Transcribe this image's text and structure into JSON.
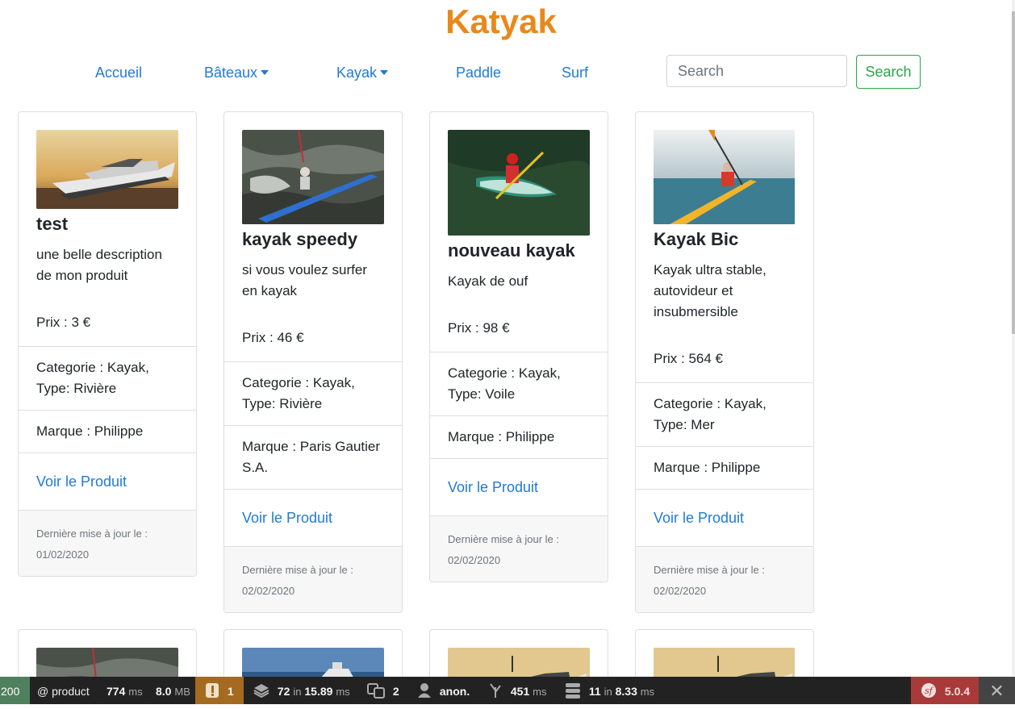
{
  "site": {
    "title": "Katyak"
  },
  "nav": {
    "accueil": "Accueil",
    "bateaux": "Bâteaux",
    "kayak": "Kayak",
    "paddle": "Paddle",
    "surf": "Surf",
    "search_placeholder": "Search",
    "search_button": "Search"
  },
  "products": [
    {
      "title": "test",
      "description": "une belle description de mon produit",
      "price": "Prix : 3 €",
      "category": "Categorie : Kayak, Type: Rivière",
      "brand": "Marque : Philippe",
      "link": "Voir le Produit",
      "updated_label": "Dernière mise à jour le :",
      "updated_date": "01/02/2020"
    },
    {
      "title": "kayak speedy",
      "description": "si vous voulez surfer en kayak",
      "price": "Prix : 46 €",
      "category": "Categorie : Kayak, Type: Rivière",
      "brand": "Marque : Paris Gautier S.A.",
      "link": "Voir le Produit",
      "updated_label": "Dernière mise à jour le :",
      "updated_date": "02/02/2020"
    },
    {
      "title": "nouveau kayak",
      "description": "Kayak de ouf",
      "price": "Prix : 98 €",
      "category": "Categorie : Kayak, Type: Voile",
      "brand": "Marque : Philippe",
      "link": "Voir le Produit",
      "updated_label": "Dernière mise à jour le :",
      "updated_date": "02/02/2020"
    },
    {
      "title": "Kayak Bic",
      "description": "Kayak ultra stable, autovideur et insubmersible",
      "price": "Prix : 564 €",
      "category": "Categorie : Kayak, Type: Mer",
      "brand": "Marque : Philippe",
      "link": "Voir le Produit",
      "updated_label": "Dernière mise à jour le :",
      "updated_date": "02/02/2020"
    }
  ],
  "toolbar": {
    "status": "200",
    "route": "@ product",
    "time_value": "774",
    "time_unit": "ms",
    "memory_value": "8.0",
    "memory_unit": "MB",
    "warnings": "1",
    "cache_count": "72",
    "cache_in": "in",
    "cache_time": "15.89",
    "cache_unit": "ms",
    "translations": "2",
    "user": "anon.",
    "render_time": "451",
    "render_unit": "ms",
    "db_queries": "11",
    "db_in": "in",
    "db_time": "8.33",
    "db_unit": "ms",
    "symfony_version": "5.0.4"
  },
  "colors": {
    "brand": "#e8891a",
    "link": "#1f7ad8",
    "success": "#28a745"
  }
}
